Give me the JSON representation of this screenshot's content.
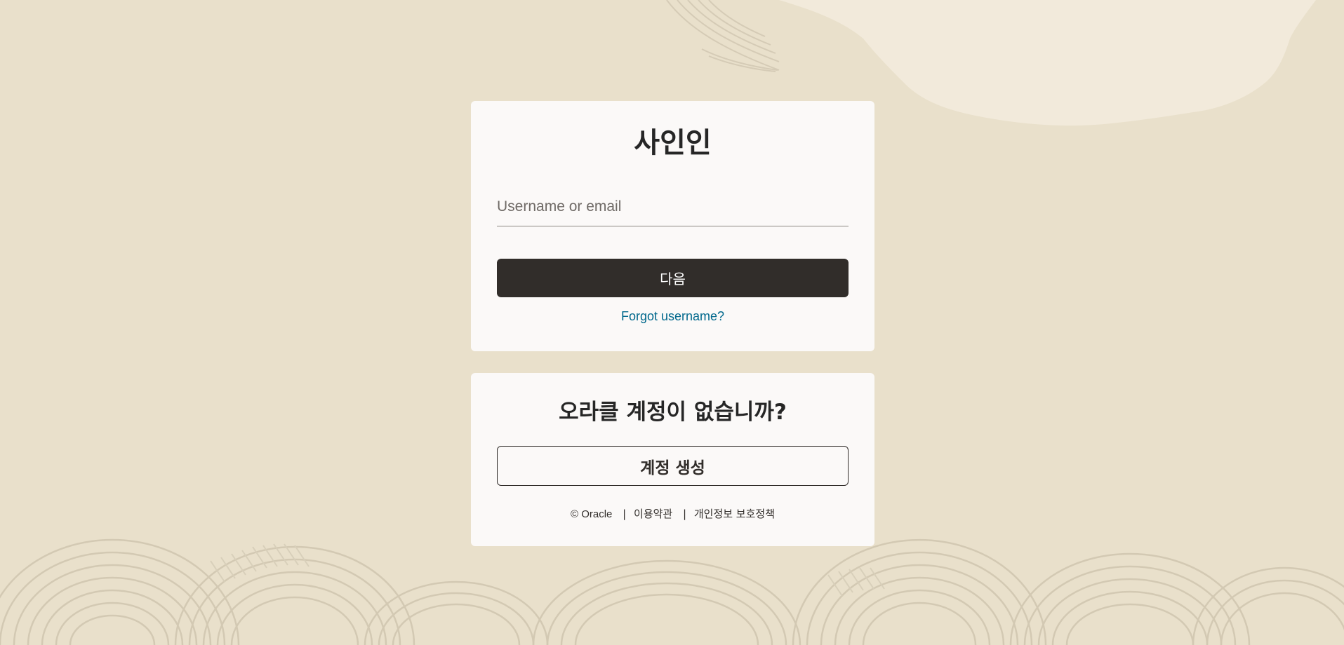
{
  "colors": {
    "background": "#e9e0cb",
    "card": "#fbf9f8",
    "primary_button": "#312d2a",
    "link": "#00688c"
  },
  "signin": {
    "title": "사인인",
    "username": {
      "placeholder": "Username or email",
      "value": ""
    },
    "next_label": "다음",
    "forgot_label": "Forgot username?"
  },
  "signup": {
    "title": "오라클 계정이 없습니까?",
    "create_label": "계정 생성"
  },
  "footer": {
    "copyright": "© Oracle",
    "separator": "|",
    "terms_label": "이용약관",
    "privacy_label": "개인정보 보호정책"
  }
}
